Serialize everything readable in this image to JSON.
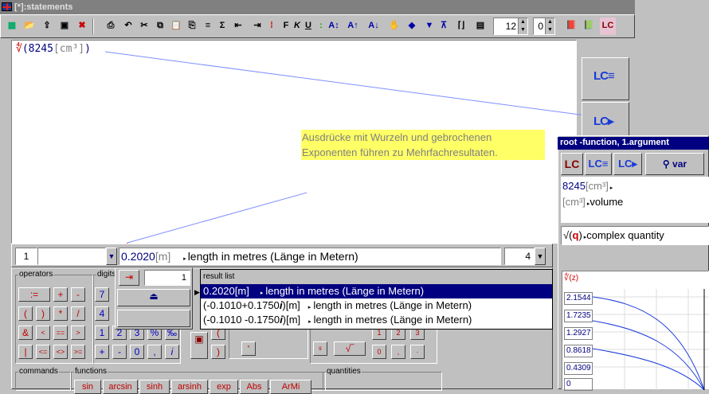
{
  "window": {
    "title": "[*]:statements"
  },
  "toolbar": {
    "f_label": "F",
    "k_label": "K",
    "u_label": "U",
    "font_size": "12",
    "precision": "0"
  },
  "editor": {
    "formula_root": "∜",
    "formula_value": "(8245",
    "formula_unit": "[cm³]",
    "formula_close": ")",
    "note_line1": "Ausdrücke mit Wurzeln und gebrochenen",
    "note_line2": "Exponenten führen zu Mehrfachresultaten."
  },
  "bottombar": {
    "index": "1",
    "result_value": "0.2020",
    "result_unit": "[m]",
    "result_desc": "length in metres (Länge in Metern)",
    "count": "4"
  },
  "lower": {
    "operators_label": "operators",
    "digits_label": "digits",
    "commands_label": "commands",
    "functions_label": "functions",
    "quantities_label": "quantities",
    "operators": [
      ":=",
      "+",
      "-",
      "(",
      ")",
      "*",
      "/",
      "&",
      "<",
      "==",
      ">",
      "|",
      "<=",
      "<>",
      ">="
    ],
    "digits": [
      "7",
      "4",
      "1",
      "2",
      "3",
      "%",
      "‰",
      "+",
      "-",
      "0",
      ",",
      "i"
    ],
    "functions": [
      "sin",
      "arcsin",
      "sinh",
      "arsinh",
      "exp",
      "Abs",
      "ArMi"
    ]
  },
  "popup": {
    "count": "1"
  },
  "result_list": {
    "header": "result list",
    "rows": [
      {
        "value": "0.2020[m]",
        "desc": "length in metres (Länge in Metern)"
      },
      {
        "value": "(-0.1010+0.1750𝒊)[m]",
        "desc": "length in metres (Länge in Metern)"
      },
      {
        "value": "(-0.1010 -0.1750𝒊)[m]",
        "desc": "length in metres (Länge in Metern)"
      }
    ]
  },
  "right_panel": {
    "title": "root -function, 1.argument",
    "var_label": "var",
    "arg_value": "8245",
    "arg_unit": "[cm³]",
    "unit_line": "[cm³]",
    "unit_desc": "volume",
    "root_symbol": "√",
    "q_symbol": "q",
    "complex_label": "complex quantity",
    "plot_title": "∜(z)",
    "plot_y": [
      "2.1544",
      "1.7235",
      "1.2927",
      "0.8618",
      "0.4309",
      "0"
    ]
  }
}
